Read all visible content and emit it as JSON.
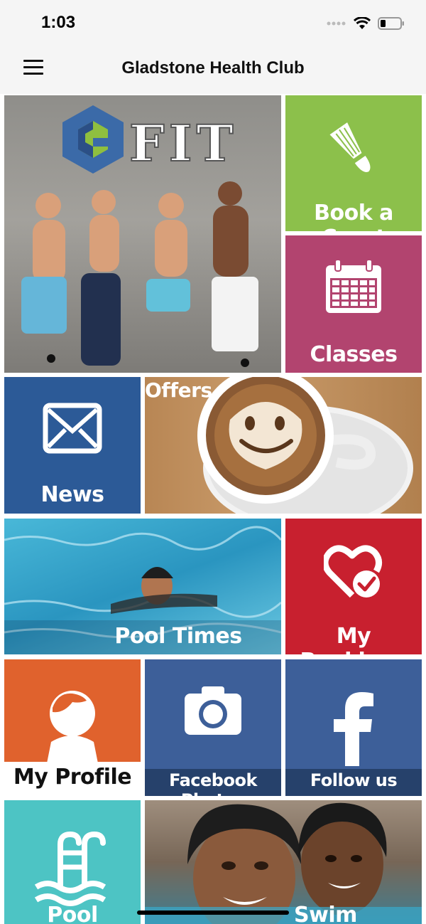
{
  "status": {
    "time": "1:03"
  },
  "header": {
    "title": "Gladstone Health Club"
  },
  "hero": {
    "logo_text": "FIT"
  },
  "tiles": {
    "book_court": "Book a Court",
    "classes": "Classes",
    "news": "News",
    "offers": "Offers",
    "pool_times": "Pool Times",
    "my_bookings": "My Bookings",
    "my_profile": "My Profile",
    "facebook_photos": "Facebook Photos",
    "follow_us": "Follow us",
    "pool_checker": "Pool checker",
    "swim_courses": "Swim Courses"
  },
  "colors": {
    "green": "#8cc04b",
    "magenta": "#b2446f",
    "blue": "#2c5a97",
    "red": "#c8202f",
    "orange": "#e0622d",
    "fb_blue": "#3d5f99",
    "teal": "#4dc4c4"
  }
}
